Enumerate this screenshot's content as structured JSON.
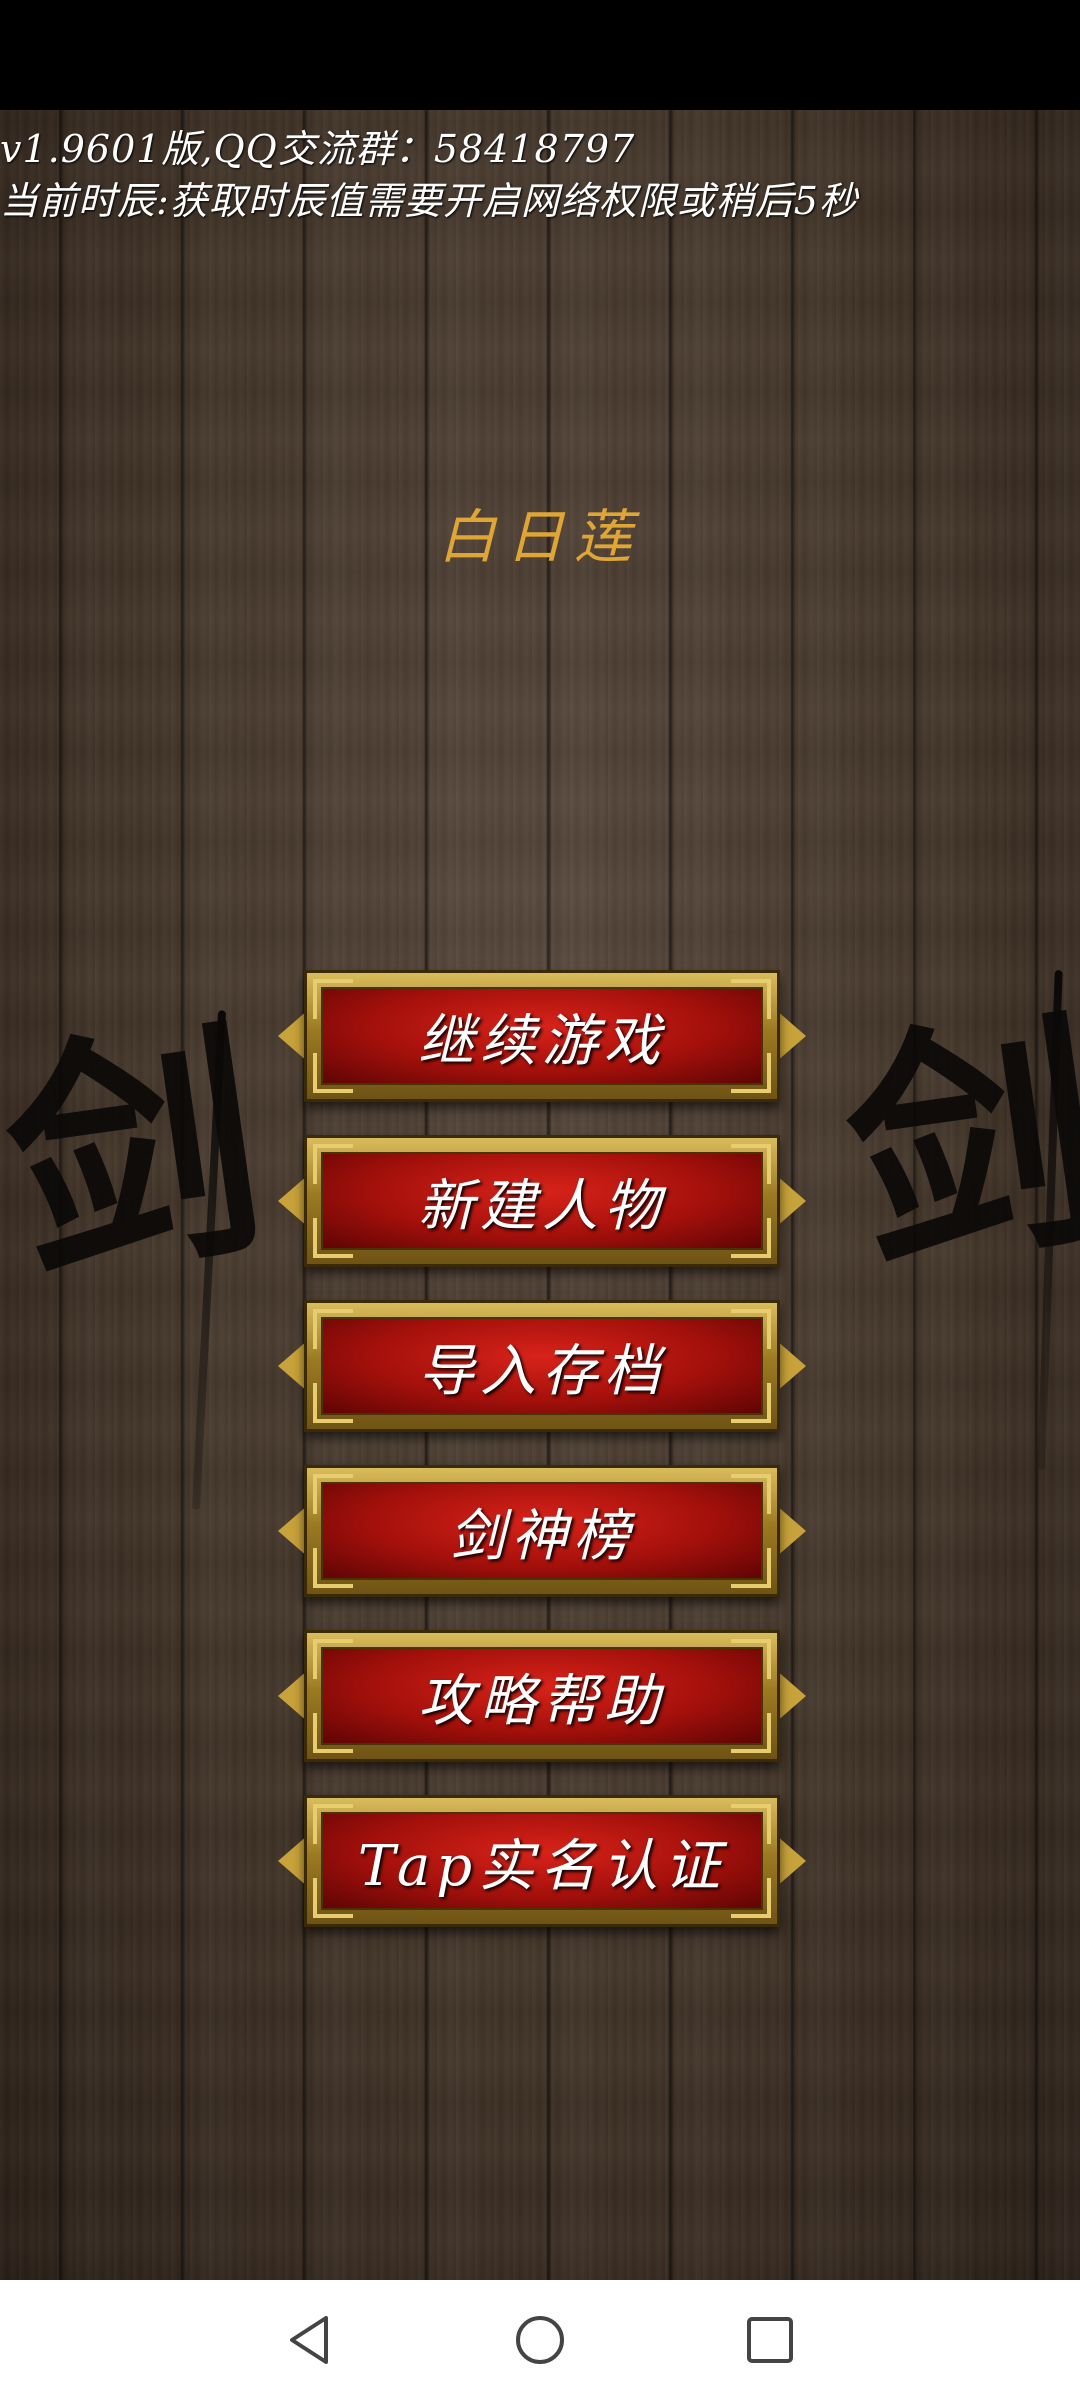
{
  "header": {
    "version_line": "v1.9601版,QQ交流群：58418797",
    "time_line": "当前时辰:获取时辰值需要开启网络权限或稍后5秒"
  },
  "player": {
    "name": "白日莲"
  },
  "decoration": {
    "calligraphy_glyph": "剑"
  },
  "menu": {
    "items": [
      {
        "label": "继续游戏"
      },
      {
        "label": "新建人物"
      },
      {
        "label": "导入存档"
      },
      {
        "label": "剑神榜"
      },
      {
        "label": "攻略帮助"
      },
      {
        "label": "Tap实名认证"
      }
    ]
  },
  "colors": {
    "player_name": "#e0a635",
    "button_red": "#b3120c",
    "button_gold": "#c8a23a",
    "wood_brown": "#433529"
  },
  "navigation": {
    "icons": [
      "back-icon",
      "home-icon",
      "recent-apps-icon"
    ]
  }
}
